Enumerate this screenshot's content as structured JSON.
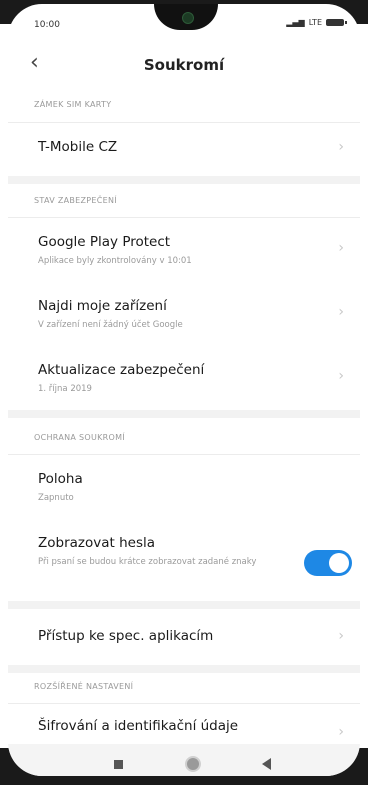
{
  "status": {
    "time": "10:00",
    "network": "LTE"
  },
  "header": {
    "back_icon": "chevron-left-icon",
    "title": "Soukromí"
  },
  "sections": [
    {
      "label": "ZÁMEK SIM KARTY"
    },
    {
      "label": "STAV ZABEZPEČENÍ"
    },
    {
      "label": "OCHRANA SOUKROMÍ"
    },
    {
      "label": "ROZŠÍŘENÉ NASTAVENÍ"
    }
  ],
  "items": {
    "sim": {
      "title": "T-Mobile CZ"
    },
    "play_protect": {
      "title": "Google Play Protect",
      "subtitle": "Aplikace byly zkontrolovány v 10:01"
    },
    "find_device": {
      "title": "Najdi moje zařízení",
      "subtitle": "V zařízení není žádný účet Google"
    },
    "security_update": {
      "title": "Aktualizace zabezpečení",
      "subtitle": "1. října 2019"
    },
    "location": {
      "title": "Poloha",
      "subtitle": "Zapnuto"
    },
    "show_passwords": {
      "title": "Zobrazovat hesla",
      "subtitle": "Při psaní se budou krátce zobrazovat zadané znaky",
      "enabled": true
    },
    "special_access": {
      "title": "Přístup ke spec. aplikacím"
    },
    "encryption": {
      "title": "Šifrování a identifikační údaje"
    }
  },
  "chevron_glyph": "›",
  "accent_color": "#1e88e5"
}
